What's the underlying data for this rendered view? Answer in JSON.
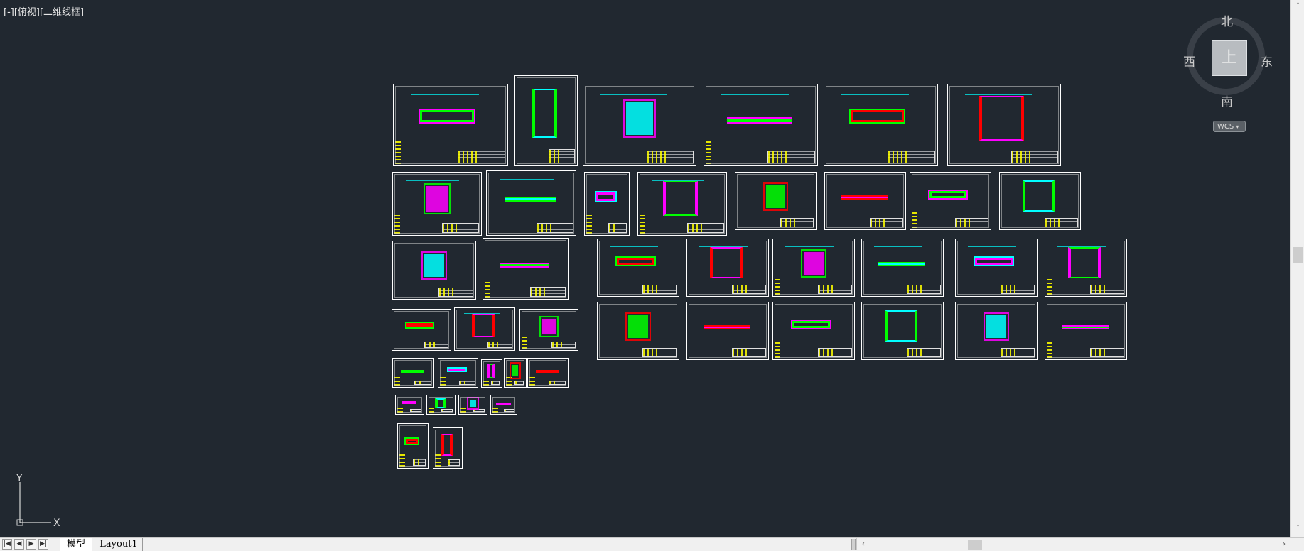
{
  "viewport": {
    "view_label": "[-][俯视][二维线框]"
  },
  "viewcube": {
    "top_face": "上",
    "north": "北",
    "south": "南",
    "east": "东",
    "west": "西",
    "wcs_label": "WCS"
  },
  "ucs": {
    "x_label": "X",
    "y_label": "Y"
  },
  "tabs": {
    "model": "模型",
    "layout1": "Layout1"
  },
  "colors": {
    "background": "#212830",
    "sheet_border": "#ffffff",
    "magenta": "#ff00ff",
    "green": "#00ff00",
    "cyan": "#00ffff",
    "yellow": "#ffff00",
    "red": "#ff0000"
  },
  "icons": {
    "nav_first": "first-layout-icon",
    "nav_prev": "prev-layout-icon",
    "nav_next": "next-layout-icon",
    "nav_last": "last-layout-icon"
  }
}
